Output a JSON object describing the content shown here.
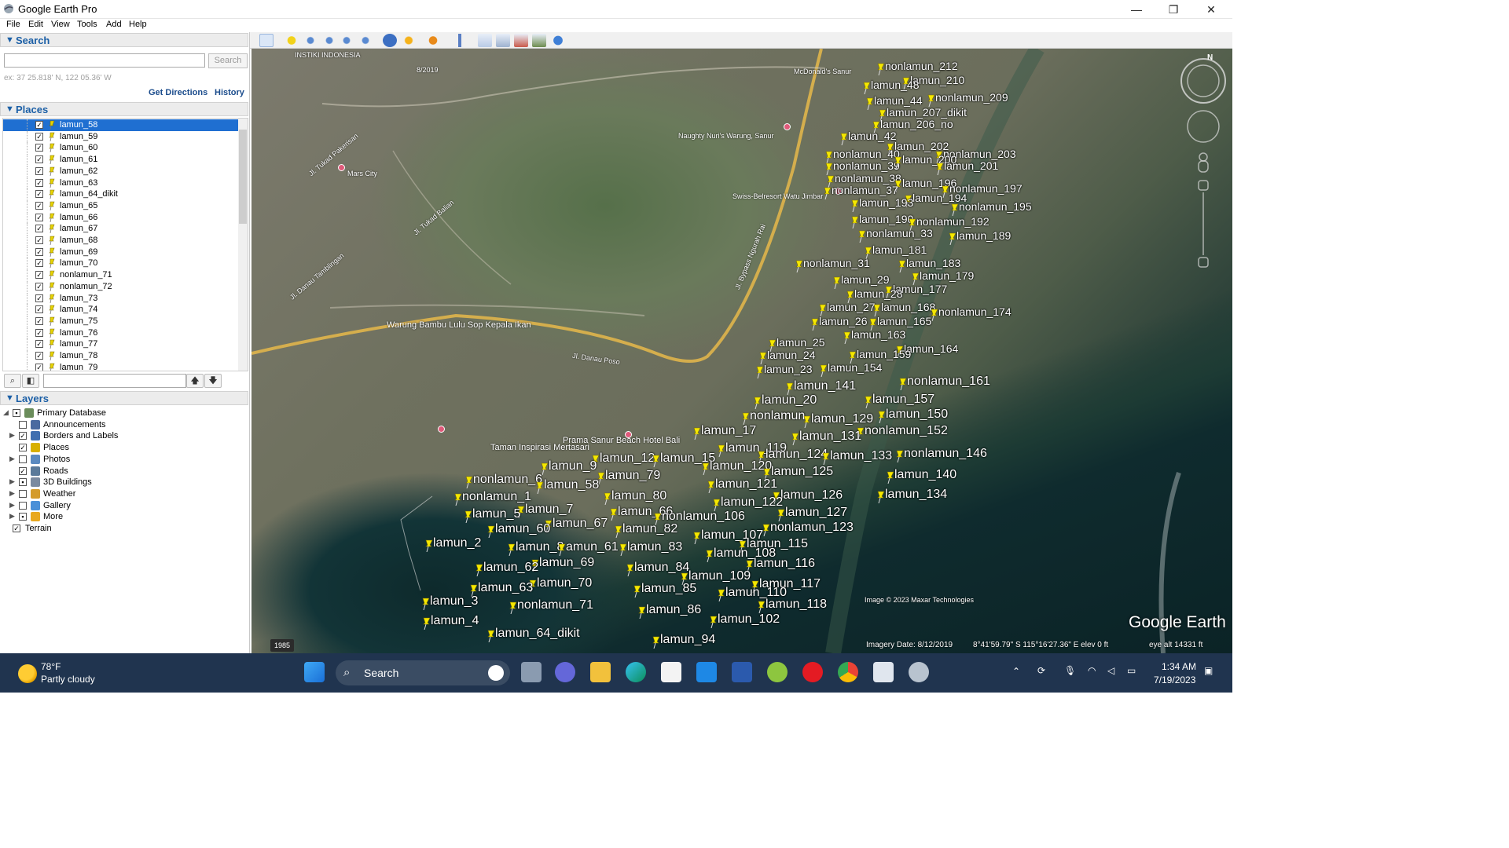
{
  "window": {
    "title": "Google Earth Pro",
    "minimize": "—",
    "restore": "❐",
    "close": "✕"
  },
  "menu": [
    "File",
    "Edit",
    "View",
    "Tools",
    "Add",
    "Help"
  ],
  "search": {
    "header": "Search",
    "input_value": "",
    "button": "Search",
    "hint": "ex: 37 25.818' N, 122 05.36' W",
    "get_directions": "Get Directions",
    "history": "History"
  },
  "places": {
    "header": "Places",
    "items": [
      "lamun_58",
      "lamun_59",
      "lamun_60",
      "lamun_61",
      "lamun_62",
      "lamun_63",
      "lamun_64_dikit",
      "lamun_65",
      "lamun_66",
      "lamun_67",
      "lamun_68",
      "lamun_69",
      "lamun_70",
      "nonlamun_71",
      "nonlamun_72",
      "lamun_73",
      "lamun_74",
      "lamun_75",
      "lamun_76",
      "lamun_77",
      "lamun_78",
      "lamun_79"
    ],
    "selected_index": 0
  },
  "layers": {
    "header": "Layers",
    "items": [
      {
        "label": "Primary Database",
        "checked": "partial",
        "icon": "database-icon",
        "level": 0,
        "expand": "open"
      },
      {
        "label": "Announcements",
        "checked": "no",
        "icon": "mail-icon",
        "level": 1,
        "expand": ""
      },
      {
        "label": "Borders and Labels",
        "checked": "yes",
        "icon": "flag-icon",
        "level": 1,
        "expand": "closed"
      },
      {
        "label": "Places",
        "checked": "yes",
        "icon": "place-icon",
        "level": 1,
        "expand": ""
      },
      {
        "label": "Photos",
        "checked": "no",
        "icon": "photo-icon",
        "level": 1,
        "expand": "closed"
      },
      {
        "label": "Roads",
        "checked": "yes",
        "icon": "road-icon",
        "level": 1,
        "expand": ""
      },
      {
        "label": "3D Buildings",
        "checked": "partial",
        "icon": "building-icon",
        "level": 1,
        "expand": "closed"
      },
      {
        "label": "Weather",
        "checked": "no",
        "icon": "weather-icon",
        "level": 1,
        "expand": "closed"
      },
      {
        "label": "Gallery",
        "checked": "no",
        "icon": "gallery-icon",
        "level": 1,
        "expand": "closed"
      },
      {
        "label": "More",
        "checked": "partial",
        "icon": "more-icon",
        "level": 1,
        "expand": "closed"
      },
      {
        "label": "Terrain",
        "checked": "yes",
        "icon": "",
        "level": 0,
        "expand": ""
      }
    ]
  },
  "map": {
    "place_labels": [
      {
        "text": "INSTIKI INDONESIA"
      },
      {
        "text": "8/2019"
      },
      {
        "text": "McDonald's Sanur"
      },
      {
        "text": "Mars City"
      },
      {
        "text": "Naughty Nuri's Warung, Sanur"
      },
      {
        "text": "Swiss-Belresort Watu Jimbar"
      },
      {
        "text": "Warung Bambu Lulu Sop Kepala Ikan"
      },
      {
        "text": "Jl. Danau Poso"
      },
      {
        "text": "Prama Sanur Beach Hotel Bali"
      },
      {
        "text": "Taman Inspirasi Mertasari"
      },
      {
        "text": "Jl. Bypass Ngurah Rai"
      },
      {
        "text": "Jl. Tukad Balian"
      },
      {
        "text": "Jl. Tukad Pakerisan"
      },
      {
        "text": "Jl. Danau Tamblingan"
      },
      {
        "text": "Image © 2023 Maxar Technologies"
      }
    ],
    "placemarks": [
      "nonlamun_212",
      "lamun_210",
      "lamun_48",
      "lamun_44",
      "nonlamun_209",
      "lamun_207_dikit",
      "lamun_206_no",
      "lamun_42",
      "lamun_202",
      "nonlamun_40",
      "nonlamun_203",
      "nonlamun_39",
      "lamun_200",
      "lamun_201",
      "nonlamun_38",
      "lamun_196",
      "nonlamun_37",
      "nonlamun_197",
      "lamun_194",
      "lamun_193",
      "nonlamun_195",
      "lamun_190",
      "nonlamun_192",
      "nonlamun_33",
      "lamun_189",
      "lamun_181",
      "nonlamun_31",
      "lamun_183",
      "lamun_179",
      "lamun_29",
      "lamun_177",
      "lamun_28",
      "lamun_27",
      "lamun_168",
      "nonlamun_174",
      "lamun_26",
      "lamun_165",
      "lamun_163",
      "lamun_25",
      "lamun_164",
      "lamun_24",
      "lamun_159",
      "lamun_23",
      "lamun_154",
      "nonlamun_161",
      "lamun_141",
      "lamun_157",
      "lamun_20",
      "lamun_150",
      "nonlamun",
      "lamun_129",
      "lamun_17",
      "nonlamun_152",
      "lamun_131",
      "lamun_119",
      "nonlamun_146",
      "lamun_124",
      "lamun_12",
      "lamun_15",
      "lamun_133",
      "lamun_9",
      "lamun_120",
      "lamun_79",
      "lamun_125",
      "nonlamun_6",
      "lamun_121",
      "lamun_140",
      "lamun_58",
      "lamun_80",
      "lamun_126",
      "lamun_134",
      "nonlamun_1",
      "lamun_122",
      "lamun_7",
      "lamun_127",
      "lamun_5",
      "lamun_66",
      "nonlamun_106",
      "lamun_67",
      "nonlamun_123",
      "lamun_60",
      "lamun_82",
      "lamun_107",
      "lamun_2",
      "lamun_115",
      "lamun_8",
      "amun_61",
      "lamun_83",
      "lamun_108",
      "lamun_69",
      "lamun_116",
      "lamun_62",
      "lamun_84",
      "lamun_109",
      "lamun_70",
      "lamun_117",
      "lamun_63",
      "lamun_85",
      "lamun_110",
      "nonlamun_71",
      "lamun_118",
      "lamun_3",
      "lamun_86",
      "lamun_102",
      "lamun_4",
      "lamun_64_dikit",
      "lamun_94"
    ],
    "logo": "Google Earth",
    "imagery_date": "Imagery Date: 8/12/2019",
    "coords": "8°41'59.79\" S   115°16'27.36\" E   elev     0 ft",
    "eye_alt": "eye alt  14331 ft",
    "historical_year": "1985",
    "compass_n": "N"
  },
  "taskbar": {
    "temp": "78°F",
    "weather": "Partly cloudy",
    "search": "Search",
    "time": "1:34 AM",
    "date": "7/19/2023"
  },
  "colors": {
    "accent": "#1b5fa6",
    "selection": "#1f6fd1",
    "placemark": "#f5e800",
    "taskbar": "#20344f"
  }
}
